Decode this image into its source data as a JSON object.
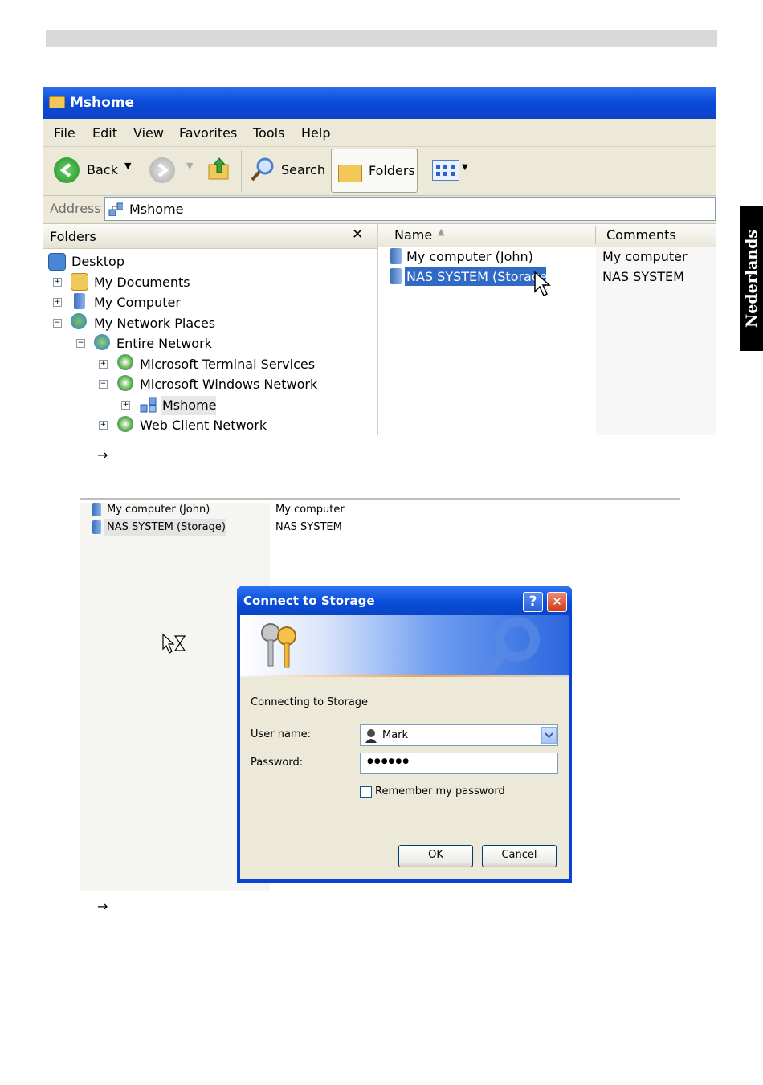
{
  "side_tab": "Nederlands",
  "explorer": {
    "title": "Mshome",
    "menu": [
      "File",
      "Edit",
      "View",
      "Favorites",
      "Tools",
      "Help"
    ],
    "toolbar": {
      "back": "Back",
      "search": "Search",
      "folders": "Folders"
    },
    "address_label": "Address",
    "address_value": "Mshome",
    "folders_header": "Folders",
    "close_glyph": "✕",
    "tree": [
      {
        "label": "Desktop",
        "expander": ""
      },
      {
        "label": "My Documents",
        "expander": "+"
      },
      {
        "label": "My Computer",
        "expander": "+"
      },
      {
        "label": "My Network Places",
        "expander": "−"
      },
      {
        "label": "Entire Network",
        "expander": "−"
      },
      {
        "label": "Microsoft Terminal Services",
        "expander": "+"
      },
      {
        "label": "Microsoft Windows Network",
        "expander": "−"
      },
      {
        "label": "Mshome",
        "expander": "+"
      },
      {
        "label": "Web Client Network",
        "expander": "+"
      }
    ],
    "columns": {
      "name": "Name",
      "comments": "Comments"
    },
    "rows": [
      {
        "name": "My computer (John)",
        "comment": "My computer"
      },
      {
        "name": "NAS SYSTEM (Storage)",
        "comment": "NAS SYSTEM"
      }
    ]
  },
  "arrow1": "→",
  "second_list": {
    "rows": [
      {
        "name": "My computer (John)",
        "comment": "My computer"
      },
      {
        "name": "NAS SYSTEM (Storage)",
        "comment": "NAS SYSTEM"
      }
    ]
  },
  "dialog": {
    "title": "Connect to Storage",
    "help_btn": "?",
    "close_btn": "✕",
    "message": "Connecting to Storage",
    "username_label": "User name:",
    "username_value": "Mark",
    "password_label": "Password:",
    "password_value": "●●●●●●",
    "remember_label": "Remember my password",
    "remember_checked": false,
    "ok": "OK",
    "cancel": "Cancel"
  },
  "arrow2": "→"
}
